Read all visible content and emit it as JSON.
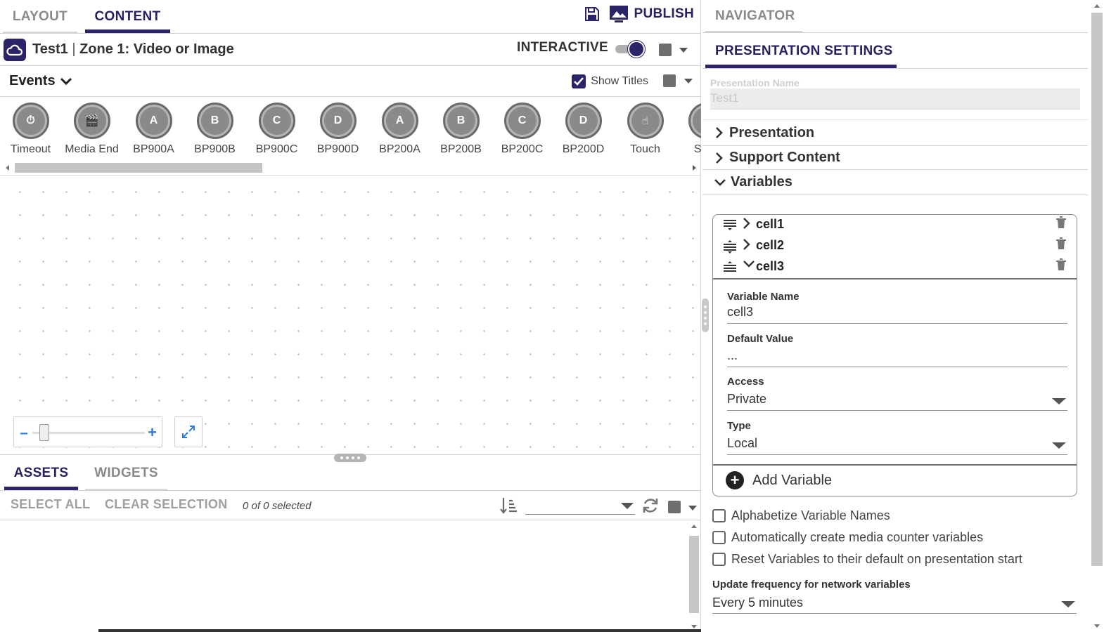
{
  "left": {
    "tabs": [
      {
        "label": "LAYOUT",
        "active": false
      },
      {
        "label": "CONTENT",
        "active": true
      }
    ],
    "toolbar": {
      "publish_label": "PUBLISH",
      "save_icon": "save-icon",
      "publish_icon": "publish-icon"
    },
    "zone": {
      "presentation": "Test1",
      "separator": "|",
      "zone_title": "Zone 1: Video or Image",
      "interactive_label": "INTERACTIVE",
      "interactive_on": true
    },
    "events": {
      "label": "Events",
      "show_titles_label": "Show Titles",
      "show_titles_checked": true
    },
    "palette": [
      {
        "label": "Timeout",
        "glyph": "⏱"
      },
      {
        "label": "Media End",
        "glyph": "🎬"
      },
      {
        "label": "BP900A",
        "glyph": "A"
      },
      {
        "label": "BP900B",
        "glyph": "B"
      },
      {
        "label": "BP900C",
        "glyph": "C"
      },
      {
        "label": "BP900D",
        "glyph": "D"
      },
      {
        "label": "BP200A",
        "glyph": "A"
      },
      {
        "label": "BP200B",
        "glyph": "B"
      },
      {
        "label": "BP200C",
        "glyph": "C"
      },
      {
        "label": "BP200D",
        "glyph": "D"
      },
      {
        "label": "Touch",
        "glyph": "☝"
      },
      {
        "label": "Sync",
        "glyph": "S"
      }
    ],
    "zoom": {
      "minus": "−",
      "plus": "+"
    },
    "asset_tabs": [
      {
        "label": "ASSETS",
        "active": true
      },
      {
        "label": "WIDGETS",
        "active": false
      }
    ],
    "asset_tools": {
      "select_all": "SELECT ALL",
      "clear_selection": "CLEAR SELECTION",
      "selected_count": "0 of 0 selected",
      "filter_value": ""
    }
  },
  "right": {
    "navigator_tab": "NAVIGATOR",
    "presentation_settings_tab": "PRESENTATION SETTINGS",
    "presentation_name_label": "Presentation Name",
    "presentation_name_value": "Test1",
    "sections": [
      {
        "label": "Presentation",
        "expanded": false
      },
      {
        "label": "Support Content",
        "expanded": false
      },
      {
        "label": "Variables",
        "expanded": true
      }
    ],
    "variables": [
      {
        "name": "cell1",
        "expanded": false
      },
      {
        "name": "cell2",
        "expanded": false
      },
      {
        "name": "cell3",
        "expanded": true
      }
    ],
    "variable_detail": {
      "name_label": "Variable Name",
      "name_value": "cell3",
      "default_label": "Default Value",
      "default_value": "...",
      "access_label": "Access",
      "access_value": "Private",
      "type_label": "Type",
      "type_value": "Local"
    },
    "add_variable_label": "Add Variable",
    "checkboxes": [
      {
        "label": "Alphabetize Variable Names",
        "checked": false
      },
      {
        "label": "Automatically create media counter variables",
        "checked": false
      },
      {
        "label": "Reset Variables to their default on presentation start",
        "checked": false
      }
    ],
    "update_freq_label": "Update frequency for network variables",
    "update_freq_value": "Every 5 minutes"
  },
  "colors": {
    "accent": "#2c2468",
    "link_blue": "#2b7be4",
    "muted": "#8a8a8a"
  }
}
